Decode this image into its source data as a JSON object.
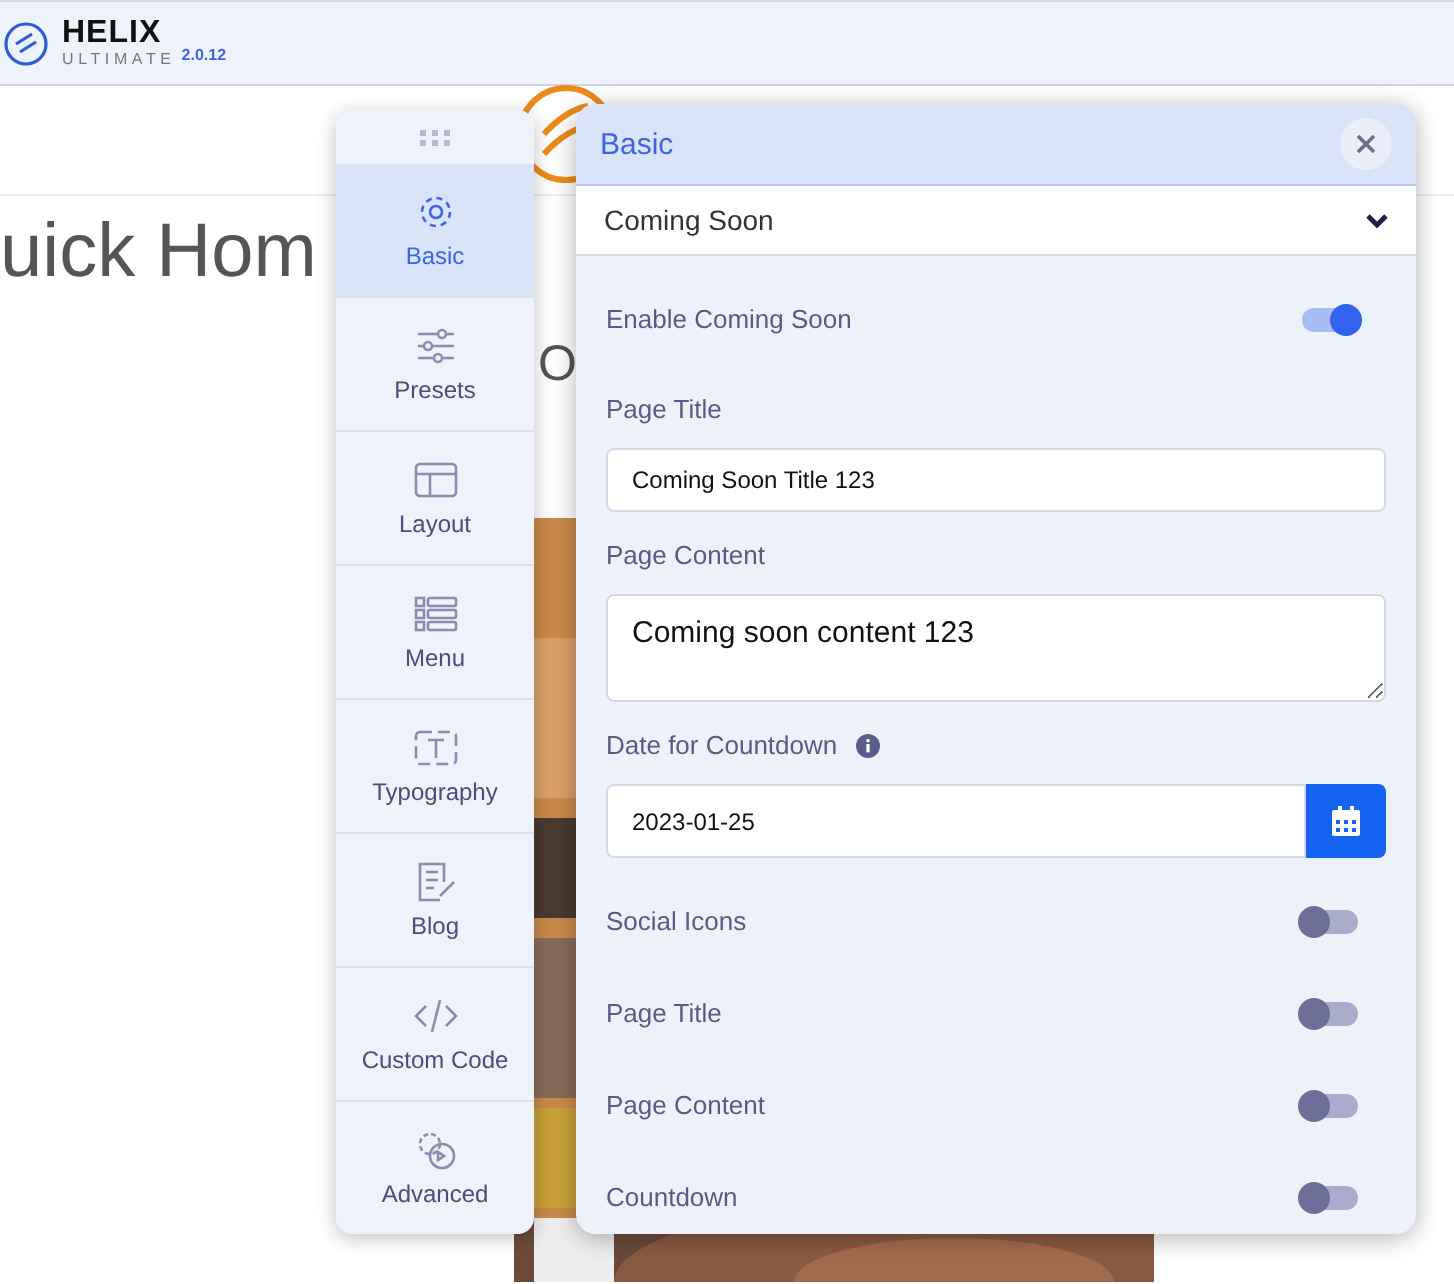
{
  "header": {
    "logo_title": "HELIX",
    "logo_subtitle": "ULTIMATE",
    "version": "2.0.12"
  },
  "page": {
    "heading": "uick Hom",
    "subheading": "O"
  },
  "sidebar": {
    "items": [
      {
        "label": "Basic",
        "kind": "gear",
        "selected": true
      },
      {
        "label": "Presets",
        "kind": "sliders",
        "selected": false
      },
      {
        "label": "Layout",
        "kind": "layout",
        "selected": false
      },
      {
        "label": "Menu",
        "kind": "list",
        "selected": false
      },
      {
        "label": "Typography",
        "kind": "type",
        "selected": false
      },
      {
        "label": "Blog",
        "kind": "note",
        "selected": false
      },
      {
        "label": "Custom Code",
        "kind": "code",
        "selected": false
      },
      {
        "label": "Advanced",
        "kind": "cogs",
        "selected": false
      }
    ]
  },
  "panel": {
    "title": "Basic",
    "section": "Coming Soon",
    "fields": [
      {
        "kind": "toggle",
        "label": "Enable Coming Soon",
        "on": true
      },
      {
        "kind": "text",
        "label": "Page Title",
        "value": "Coming Soon Title 123"
      },
      {
        "kind": "textarea",
        "label": "Page Content",
        "value": "Coming soon content 123"
      },
      {
        "kind": "date",
        "label": "Date for Countdown",
        "info": true,
        "value": "2023-01-25"
      },
      {
        "kind": "toggle",
        "label": "Social Icons",
        "on": false
      },
      {
        "kind": "toggle",
        "label": "Page Title",
        "on": false
      },
      {
        "kind": "toggle",
        "label": "Page Content",
        "on": false
      },
      {
        "kind": "toggle",
        "label": "Countdown",
        "on": false
      }
    ]
  }
}
